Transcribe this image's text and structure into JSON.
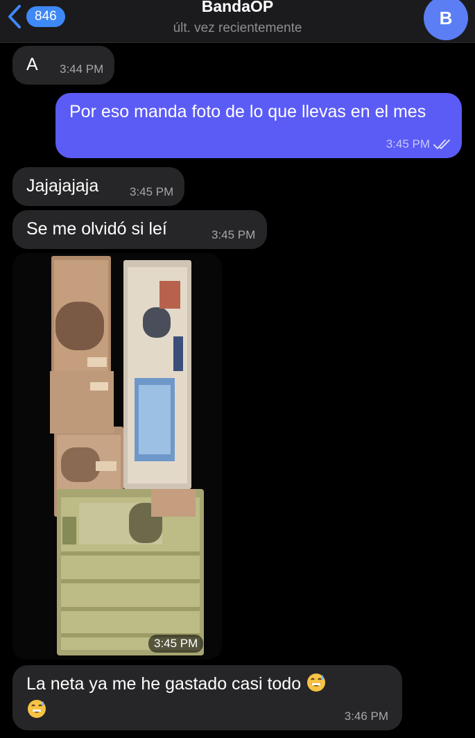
{
  "header": {
    "back_count": "846",
    "title": "BandaOP",
    "subtitle": "últ. vez recientemente",
    "avatar_letter": "B"
  },
  "messages": [
    {
      "direction": "incoming",
      "text": "A",
      "time": "3:44 PM"
    },
    {
      "direction": "outgoing",
      "text": "Por eso manda foto de lo que llevas en el mes",
      "time": "3:45 PM",
      "status": "read"
    },
    {
      "direction": "incoming",
      "text": "Jajajajaja",
      "time": "3:45 PM"
    },
    {
      "direction": "incoming",
      "text": "Se me olvidó si leí",
      "time": "3:45 PM"
    },
    {
      "direction": "incoming",
      "type": "photo",
      "time": "3:45 PM",
      "photo_subject": "stacks of Mexican peso banknotes"
    },
    {
      "direction": "incoming",
      "text": "La neta ya me he gastado casi todo",
      "emoji": "grinning-sweat-emoji",
      "time": "3:46 PM"
    }
  ],
  "colors": {
    "background": "#000000",
    "incoming_bubble": "#262628",
    "outgoing_bubble": "#5b5bf6",
    "accent": "#3e88f7"
  }
}
